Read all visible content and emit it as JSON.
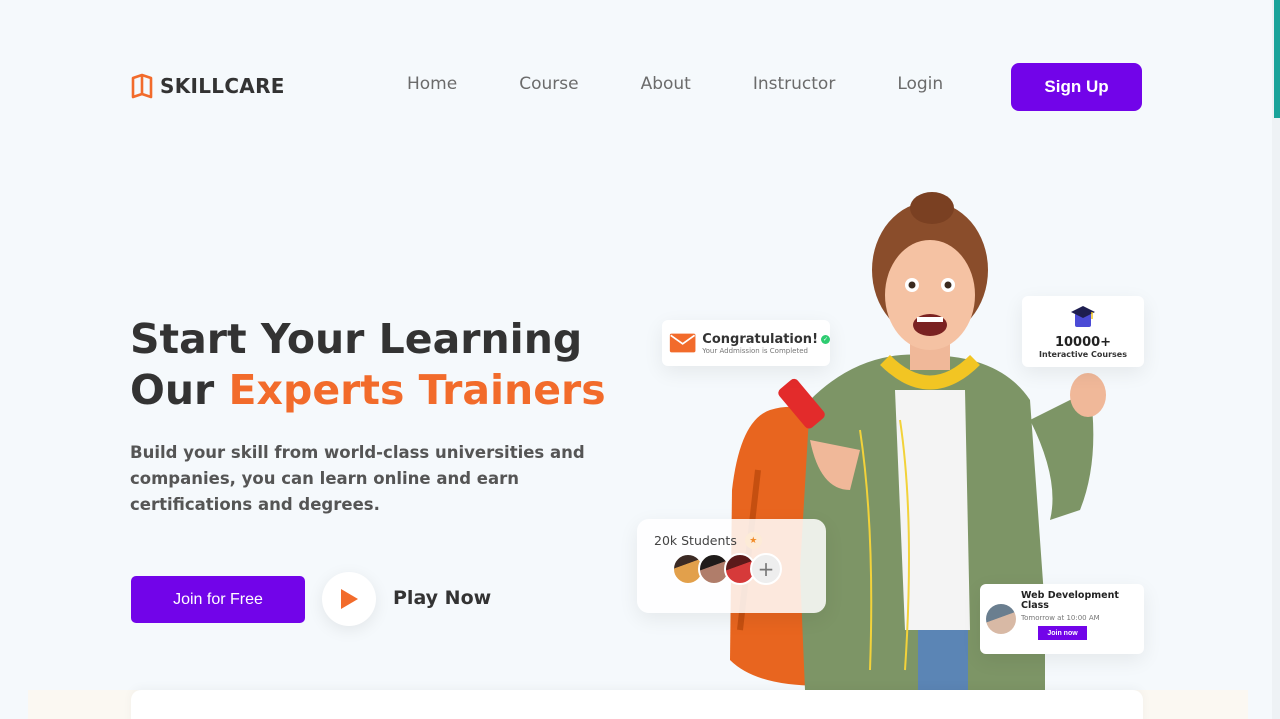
{
  "brand": {
    "name": "SKILLCARE",
    "color": "#f26b2b"
  },
  "nav": {
    "items": [
      "Home",
      "Course",
      "About",
      "Instructor",
      "Login"
    ],
    "signup_label": "Sign Up"
  },
  "hero": {
    "title_line1": "Start Your Learning",
    "title_line2_prefix": "Our ",
    "title_line2_accent": "Experts Trainers",
    "description": "Build your skill from world-class universities and companies, you can learn online and earn certifications and degrees.",
    "join_label": "Join for Free",
    "play_label": "Play Now"
  },
  "cards": {
    "congrats": {
      "title": "Congratulation!",
      "subtitle": "Your Addmission is Completed",
      "icon": "mail-icon"
    },
    "courses": {
      "count": "10000+",
      "label": "Interactive Courses",
      "icon": "graduation-cap-icon"
    },
    "students": {
      "label": "20k Students",
      "add_symbol": "+"
    },
    "webdev": {
      "title": "Web Development Class",
      "time": "Tomorrow at 10:00 AM",
      "join_label": "Join now"
    }
  },
  "colors": {
    "primary": "#7204e9",
    "accent": "#f26b2b",
    "background": "#f5f9fc"
  }
}
